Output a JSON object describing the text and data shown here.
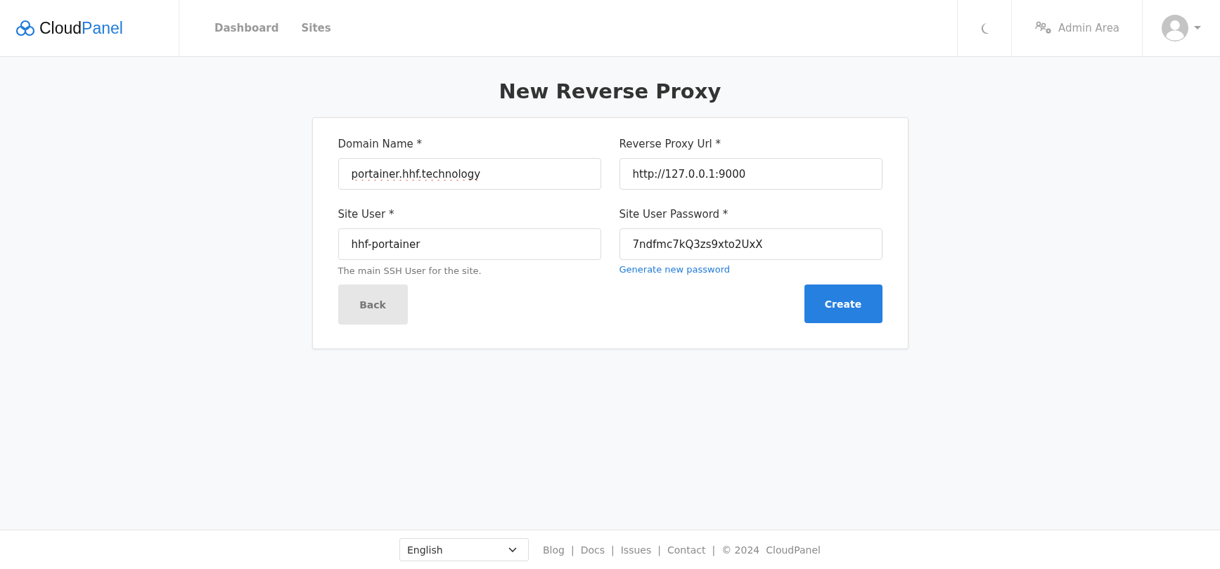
{
  "header": {
    "logo": {
      "part_1": "Cloud",
      "part_2": "Panel"
    },
    "nav": [
      {
        "label": "Dashboard",
        "selected": false
      },
      {
        "label": "Sites",
        "selected": false
      }
    ],
    "admin_area": "Admin Area"
  },
  "page_title": "New Reverse Proxy",
  "form": {
    "fields": [
      {
        "label": "Domain Name *",
        "value": "portainer.hhf.technology",
        "spellcheck_error": true
      },
      {
        "label": "Reverse Proxy Url *",
        "value": "http://127.0.0.1:9000",
        "spellcheck_error": false
      },
      {
        "label": "Site User *",
        "value": "hhf-portainer",
        "spellcheck_error": false,
        "help": "The main SSH User for the site."
      },
      {
        "label": "Site User Password *",
        "value": "7ndfmc7kQ3zs9xto2UxX",
        "spellcheck_error": false,
        "link": "Generate new password"
      }
    ],
    "back_button": "Back",
    "create_button": "Create"
  },
  "footer": {
    "language": "English",
    "links": [
      "Blog",
      "Docs",
      "Issues",
      "Contact"
    ],
    "separator": "|",
    "copyright": "© 2024",
    "brand": "CloudPanel"
  }
}
